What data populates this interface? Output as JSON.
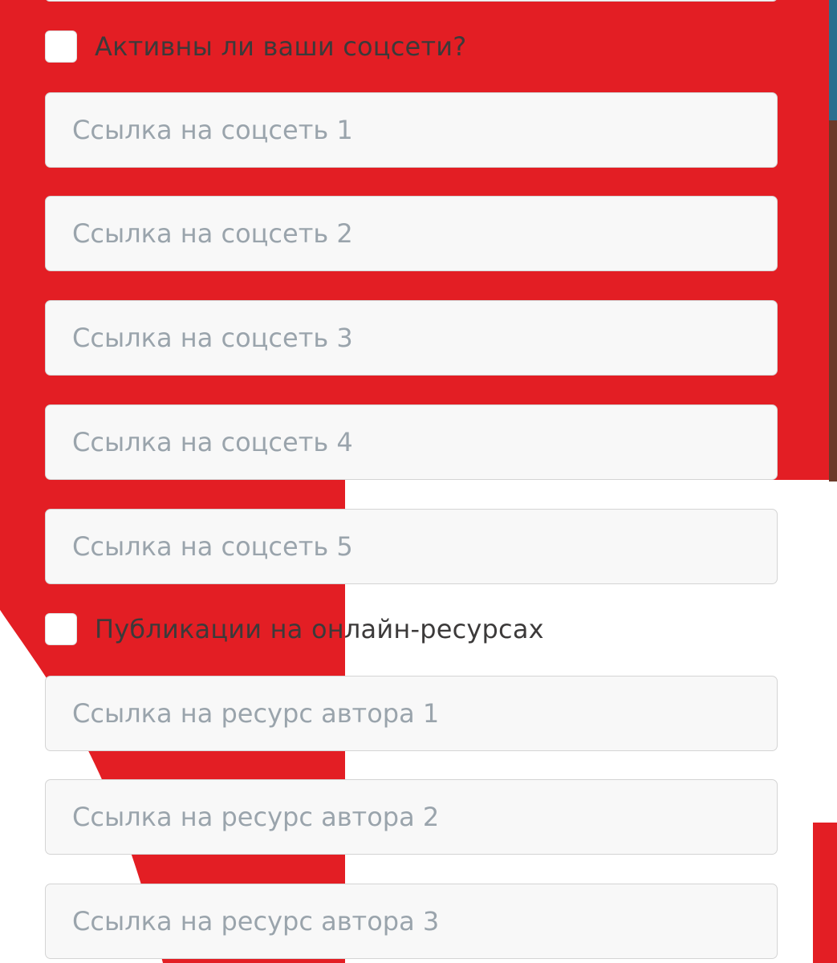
{
  "theme": {
    "background": "#ffffff",
    "accent": "#e31e24",
    "input_bg": "#f8f8f8",
    "input_border": "#d4d4d4",
    "placeholder_color": "#9aa4ac",
    "label_color": "#3c3a3a"
  },
  "social": {
    "checkbox_label": "Активны ли ваши соцсети?",
    "checked": false,
    "fields": [
      {
        "placeholder": "Ссылка на соцсеть 1",
        "value": ""
      },
      {
        "placeholder": "Ссылка на соцсеть 2",
        "value": ""
      },
      {
        "placeholder": "Ссылка на соцсеть 3",
        "value": ""
      },
      {
        "placeholder": "Ссылка на соцсеть 4",
        "value": ""
      },
      {
        "placeholder": "Ссылка на соцсеть 5",
        "value": ""
      }
    ]
  },
  "publications": {
    "checkbox_label": "Публикации на онлайн-ресурсах",
    "checked": false,
    "fields": [
      {
        "placeholder": "Ссылка на ресурс автора 1",
        "value": ""
      },
      {
        "placeholder": "Ссылка на ресурс автора 2",
        "value": ""
      },
      {
        "placeholder": "Ссылка на ресурс автора 3",
        "value": ""
      }
    ]
  }
}
